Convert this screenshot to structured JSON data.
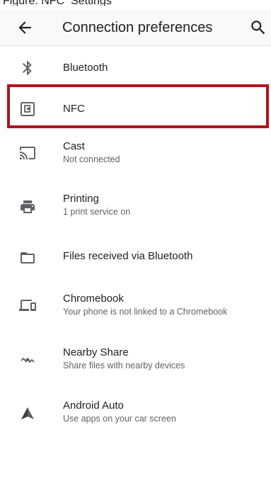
{
  "caption": "Figure: NFC_Settings",
  "appbar": {
    "title": "Connection preferences",
    "back_icon": "arrow-back-icon",
    "search_icon": "search-icon"
  },
  "items": [
    {
      "label": "Bluetooth",
      "summary": "",
      "icon": "bluetooth-icon"
    },
    {
      "label": "NFC",
      "summary": "",
      "icon": "nfc-icon"
    },
    {
      "label": "Cast",
      "summary": "Not connected",
      "icon": "cast-icon"
    },
    {
      "label": "Printing",
      "summary": "1 print service on",
      "icon": "printer-icon"
    },
    {
      "label": "Files received via Bluetooth",
      "summary": "",
      "icon": "folder-icon"
    },
    {
      "label": "Chromebook",
      "summary": "Your phone is not linked to a Chromebook",
      "icon": "chromebook-icon"
    },
    {
      "label": "Nearby Share",
      "summary": "Share files with nearby devices",
      "icon": "nearby-share-icon"
    },
    {
      "label": "Android Auto",
      "summary": "Use apps on your car screen",
      "icon": "android-auto-icon"
    }
  ],
  "colors": {
    "highlight": "#b3121b",
    "icon": "#5f6368",
    "text_primary": "#202124",
    "text_secondary": "#5f6368"
  }
}
